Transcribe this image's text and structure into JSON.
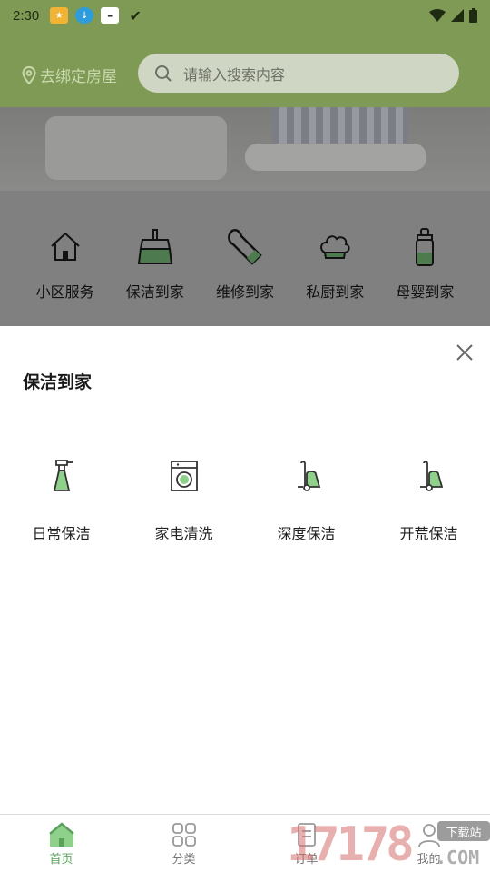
{
  "status_bar": {
    "time": "2:30"
  },
  "header": {
    "location_label": "去绑定房屋",
    "search_placeholder": "请输入搜索内容"
  },
  "categories": [
    {
      "label": "小区服务",
      "icon": "house-icon"
    },
    {
      "label": "保洁到家",
      "icon": "broom-icon"
    },
    {
      "label": "维修到家",
      "icon": "wrench-icon"
    },
    {
      "label": "私厨到家",
      "icon": "chef-hat-icon"
    },
    {
      "label": "母婴到家",
      "icon": "baby-bottle-icon"
    }
  ],
  "sheet": {
    "title": "保洁到家",
    "items": [
      {
        "label": "日常保洁",
        "icon": "spray-bottle-icon"
      },
      {
        "label": "家电清洗",
        "icon": "washing-machine-icon"
      },
      {
        "label": "深度保洁",
        "icon": "vacuum-icon"
      },
      {
        "label": "开荒保洁",
        "icon": "vacuum-cleaner-icon"
      }
    ]
  },
  "bottom_nav": [
    {
      "label": "首页",
      "icon": "home-icon",
      "active": true
    },
    {
      "label": "分类",
      "icon": "grid-icon",
      "active": false
    },
    {
      "label": "订单",
      "icon": "order-icon",
      "active": false
    },
    {
      "label": "我的",
      "icon": "user-icon",
      "active": false
    }
  ],
  "watermark": {
    "number": "17178",
    "tag": "下载站",
    "domain": ".COM"
  },
  "colors": {
    "accent_green": "#7f9a55",
    "active_nav": "#5aa15c",
    "overlay": "#808080"
  }
}
